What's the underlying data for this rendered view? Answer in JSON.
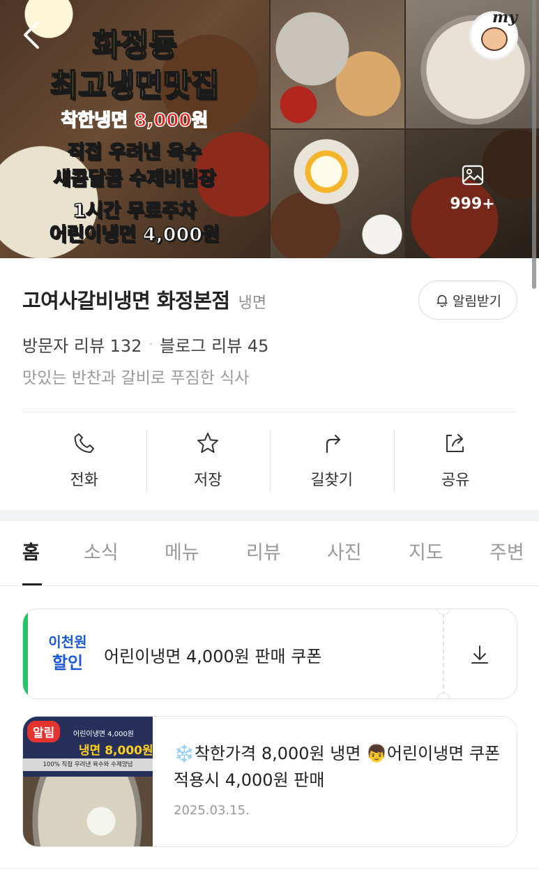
{
  "hero": {
    "promo_title_line1": "화정동",
    "promo_title_line2_a": "최고",
    "promo_title_line2_b": "냉면",
    "promo_title_line2_c": "맛집",
    "promo_price_label": "착한냉면",
    "promo_price_value": "8,000원",
    "promo_line1": "직접 우려낸 육수",
    "promo_line2": "새콤달콤 수제비빔장",
    "promo_line3": "1시간 무료주차",
    "promo_line4": "어린이냉면 4,000원",
    "my_label": "my",
    "photo_count": "999+"
  },
  "place": {
    "name": "고여사갈비냉면 화정본점",
    "category": "냉면",
    "notify_label": "알림받기",
    "visitor_review": "방문자 리뷰 132",
    "blog_review": "블로그 리뷰 45",
    "separator": "·",
    "description": "맛있는 반찬과 갈비로 푸짐한 식사"
  },
  "actions": [
    {
      "label": "전화",
      "icon": "phone-icon"
    },
    {
      "label": "저장",
      "icon": "star-icon"
    },
    {
      "label": "길찾기",
      "icon": "directions-icon"
    },
    {
      "label": "공유",
      "icon": "share-icon"
    }
  ],
  "tabs": [
    "홈",
    "소식",
    "메뉴",
    "리뷰",
    "사진",
    "지도",
    "주변"
  ],
  "active_tab": "홈",
  "coupon": {
    "badge_line1": "이천원",
    "badge_line2": "할인",
    "text": "어린이냉면 4,000원 판매 쿠폰",
    "accent_color": "#1ec864"
  },
  "news": {
    "thumb_tag": "알림",
    "thumb_small": "어린이냉면 4,000원",
    "thumb_big": "냉면 8,000원",
    "thumb_strip": "100% 직접 우려낸 육수와 수제양념",
    "title": "❄️착한가격 8,000원 냉면 👦어린이냉면 쿠폰적용시 4,000원 판매",
    "date": "2025.03.15."
  },
  "colors": {
    "text_primary": "#222222",
    "text_secondary": "#9a9a9a",
    "badge_blue": "#1a5ad8",
    "alert_red": "#e3342f"
  }
}
